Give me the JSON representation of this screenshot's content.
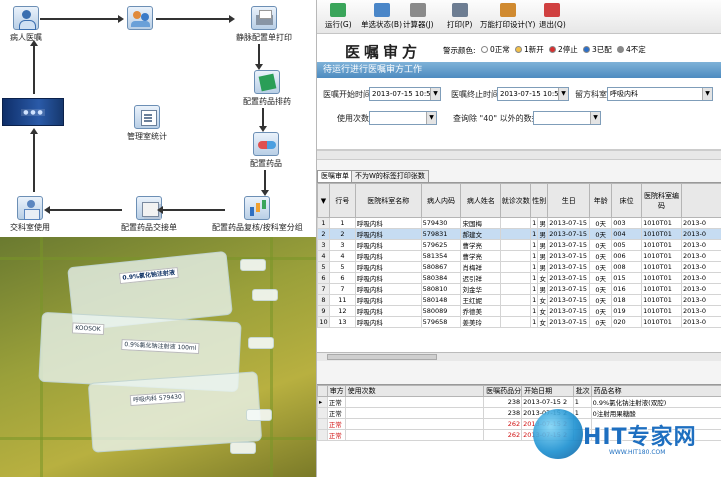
{
  "flow": {
    "nodes": {
      "doctor": "病人医嘱",
      "print": "静脉配置单打印",
      "label": "配置药品排药",
      "dispense": "配置药品",
      "review": "配置药品复核/按科室分组",
      "handover": "配置药品交接单",
      "ward": "交科室使用",
      "manage": "管理室统计"
    }
  },
  "photo": {
    "tags": [
      "0.9%氯化钠注射液",
      "KOOSOK",
      "0.9%氯化钠注射液 100ml",
      "呼吸内科 579430"
    ]
  },
  "toolbar": {
    "buttons": [
      "运行(G)",
      "单选状态(B)",
      "计算器(J)",
      "打印(P)",
      "万能打印设计(Y)",
      "退出(Q)"
    ]
  },
  "header": {
    "title": "医嘱审方",
    "legend_label": "警示颜色:",
    "legend": [
      {
        "label": "0正常",
        "color": "#ffffff"
      },
      {
        "label": "1新开",
        "color": "#f2c04a"
      },
      {
        "label": "2停止",
        "color": "#d63030"
      },
      {
        "label": "3已配",
        "color": "#2a6fc9"
      },
      {
        "label": "4不定",
        "color": "#8a8a8a"
      }
    ]
  },
  "section_bar": "待运行进行医嘱审方工作",
  "filters": {
    "start_label": "医嘱开始时间",
    "start_value": "2013-07-15 10:54:05",
    "end_label": "医嘱终止时间",
    "end_value": "2013-07-15 10:54:05",
    "dept_label": "留方科室",
    "dept_value": "呼吸内科",
    "count_label": "使用次数",
    "count_value": "",
    "query_label": "查询除 \"40\" 以外的数据",
    "query_value": ""
  },
  "tabs": [
    "医嘱审单",
    "不为W的标签打印张数"
  ],
  "grid1": {
    "columns": [
      "行号",
      "医院科室名称",
      "病人内码",
      "病人姓名",
      "就诊次数",
      "性别",
      "生日",
      "年龄",
      "床位",
      "医院科室编码",
      ""
    ],
    "rows": [
      [
        "1",
        "呼吸内科",
        "579430",
        "宋国梅",
        "",
        "1",
        "男",
        "2013-07-15",
        "0天",
        "003",
        "1010T01",
        "2013-0"
      ],
      [
        "2",
        "呼吸内科",
        "579831",
        "郝建文",
        "",
        "1",
        "男",
        "2013-07-15",
        "0天",
        "004",
        "1010T01",
        "2013-0"
      ],
      [
        "3",
        "呼吸内科",
        "579625",
        "曹学亮",
        "",
        "1",
        "男",
        "2013-07-15",
        "0天",
        "005",
        "1010T01",
        "2013-0"
      ],
      [
        "4",
        "呼吸内科",
        "581354",
        "曹学亮",
        "",
        "1",
        "男",
        "2013-07-15",
        "0天",
        "006",
        "1010T01",
        "2013-0"
      ],
      [
        "5",
        "呼吸内科",
        "580867",
        "肖梅祥",
        "",
        "1",
        "男",
        "2013-07-15",
        "0天",
        "008",
        "1010T01",
        "2013-0"
      ],
      [
        "6",
        "呼吸内科",
        "580384",
        "迟引祥",
        "",
        "1",
        "女",
        "2013-07-15",
        "0天",
        "015",
        "1010T01",
        "2013-0"
      ],
      [
        "7",
        "呼吸内科",
        "580810",
        "刘金华",
        "",
        "1",
        "男",
        "2013-07-15",
        "0天",
        "016",
        "1010T01",
        "2013-0"
      ],
      [
        "11",
        "呼吸内科",
        "580148",
        "王红妮",
        "",
        "1",
        "女",
        "2013-07-15",
        "0天",
        "018",
        "1010T01",
        "2013-0"
      ],
      [
        "12",
        "呼吸内科",
        "580089",
        "乔德美",
        "",
        "1",
        "女",
        "2013-07-15",
        "0天",
        "019",
        "1010T01",
        "2013-0"
      ],
      [
        "13",
        "呼吸内科",
        "579658",
        "姜美玲",
        "",
        "1",
        "女",
        "2013-07-15",
        "0天",
        "020",
        "1010T01",
        "2013-0"
      ]
    ]
  },
  "grid2": {
    "columns": [
      "审方",
      "使用次数",
      "医嘱药品分",
      "开始日期",
      "批次",
      "药品名称"
    ],
    "rows": [
      {
        "status": "正常",
        "count": "",
        "code": "238",
        "date": "2013-07-15 2",
        "batch": "1",
        "drug": "0.9%氯化钠注射液(双腔)",
        "red": false
      },
      {
        "status": "正常",
        "count": "",
        "code": "238",
        "date": "2013-07-15 2",
        "batch": "1",
        "drug": "0注射用果糖酸",
        "red": false
      },
      {
        "status": "正常",
        "count": "",
        "code": "262",
        "date": "2013-07-15 2",
        "batch": "",
        "drug": "",
        "red": true
      },
      {
        "status": "正常",
        "count": "",
        "code": "262",
        "date": "2013-07-15 2",
        "batch": "",
        "drug": "",
        "red": true
      }
    ]
  },
  "watermark": {
    "brand": "HIT专家网",
    "url": "WWW.HIT180.COM"
  }
}
